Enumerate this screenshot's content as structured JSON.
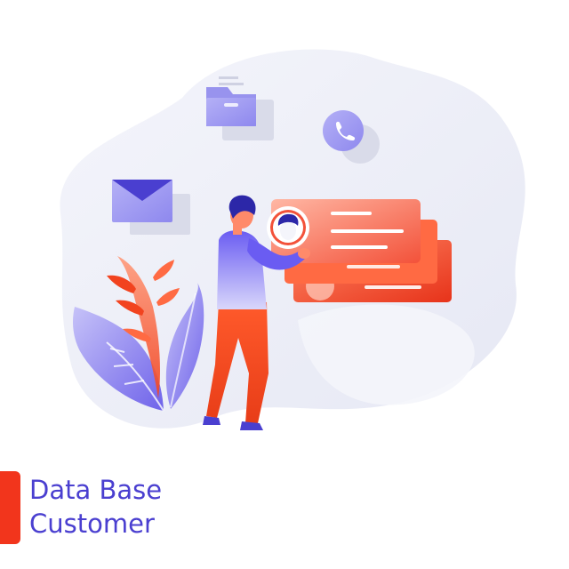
{
  "heading": {
    "line1": "Data Base",
    "line2": "Customer"
  },
  "colors": {
    "brand_purple": "#4a3fd0",
    "accent_red": "#f2351c",
    "blob": "#eef0f8",
    "lavender": "#a6a3f2"
  },
  "icons": [
    "folder-icon",
    "phone-icon",
    "mail-icon",
    "profile-icon"
  ]
}
